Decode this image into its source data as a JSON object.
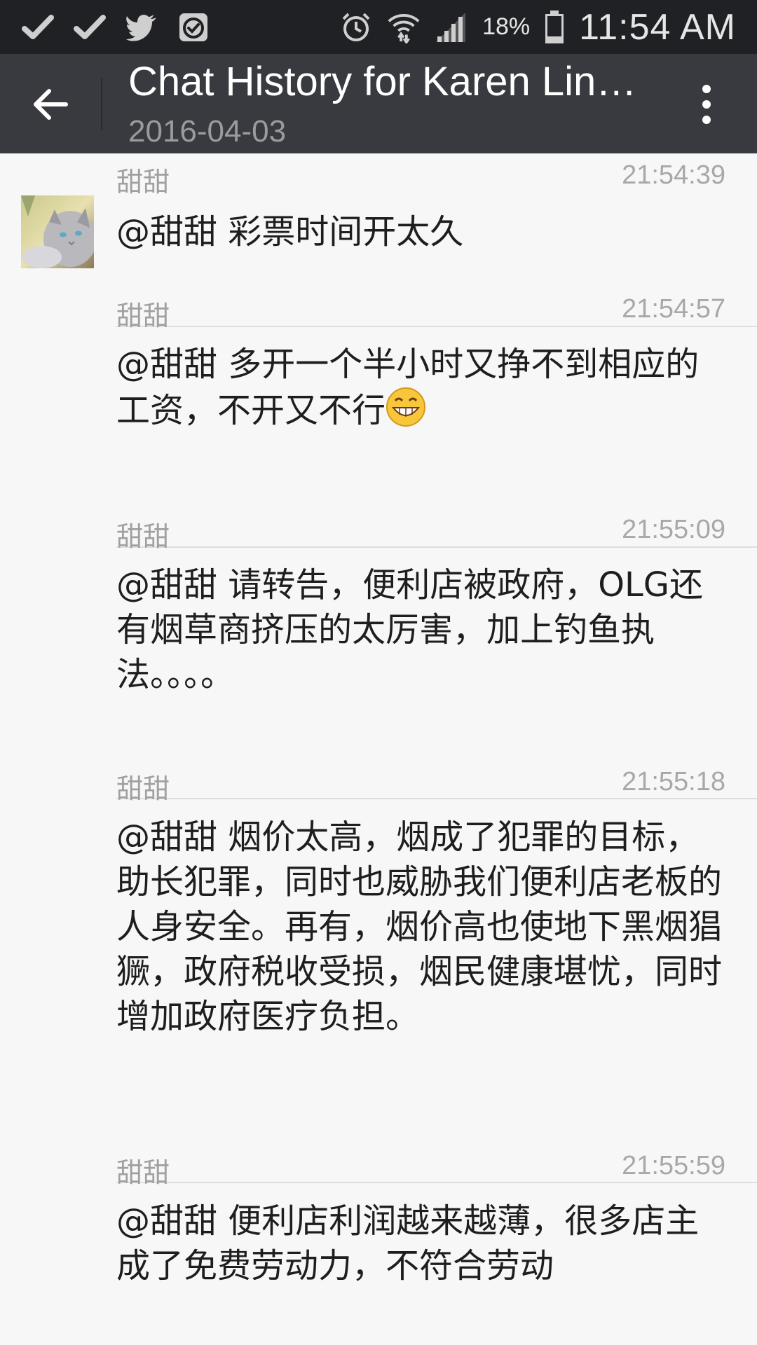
{
  "status_bar": {
    "icons_left": [
      "check-icon",
      "check-icon",
      "twitter-icon",
      "task-check-icon"
    ],
    "icons_right": [
      "alarm-icon",
      "wifi-icon",
      "signal-icon"
    ],
    "battery_percent": "18%",
    "time": "11:54 AM"
  },
  "app_bar": {
    "title": "Chat History for Karen Lin…",
    "date": "2016-04-03"
  },
  "messages": [
    {
      "sender": "甜甜",
      "time": "21:54:39",
      "text": "@甜甜 彩票时间开太久"
    },
    {
      "sender": "甜甜",
      "time": "21:54:57",
      "text": "@甜甜 多开一个半小时又挣不到相应的工资，不开又不行"
    },
    {
      "sender": "甜甜",
      "time": "21:55:09",
      "text": "@甜甜 请转告，便利店被政府，OLG还有烟草商挤压的太厉害，加上钓鱼执法。。。。"
    },
    {
      "sender": "甜甜",
      "time": "21:55:18",
      "text": "@甜甜 烟价太高，烟成了犯罪的目标，助长犯罪，同时也威胁我们便利店老板的人身安全。再有，烟价高也使地下黑烟猖獗，政府税收受损，烟民健康堪忧，同时增加政府医疗负担。"
    },
    {
      "sender": "甜甜",
      "time": "21:55:59",
      "text": "@甜甜 便利店利润越来越薄，很多店主成了免费劳动力，不符合劳动"
    }
  ],
  "colors": {
    "status_bar_bg": "#202124",
    "app_bar_bg": "#393a3f",
    "list_bg": "#f7f7f7",
    "separator": "#dedede"
  }
}
